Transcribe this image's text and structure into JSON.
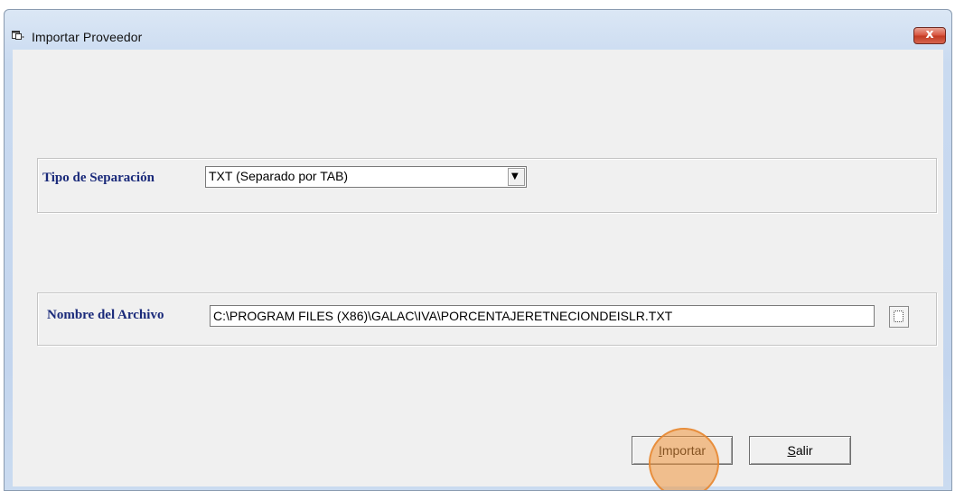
{
  "window": {
    "title": "Importar Proveedor",
    "close_label": "x"
  },
  "separation": {
    "label": "Tipo de Separación",
    "selected": "TXT (Separado por TAB)"
  },
  "file": {
    "label": "Nombre del Archivo",
    "value": "C:\\PROGRAM FILES (X86)\\GALAC\\IVA\\PORCENTAJERETNECIONDEISLR.TXT"
  },
  "buttons": {
    "import_mnemonic": "I",
    "import_rest": "mportar",
    "exit_mnemonic": "S",
    "exit_rest": "alir"
  },
  "colors": {
    "label_text": "#1a2a7a",
    "highlight": "#f0963c"
  }
}
